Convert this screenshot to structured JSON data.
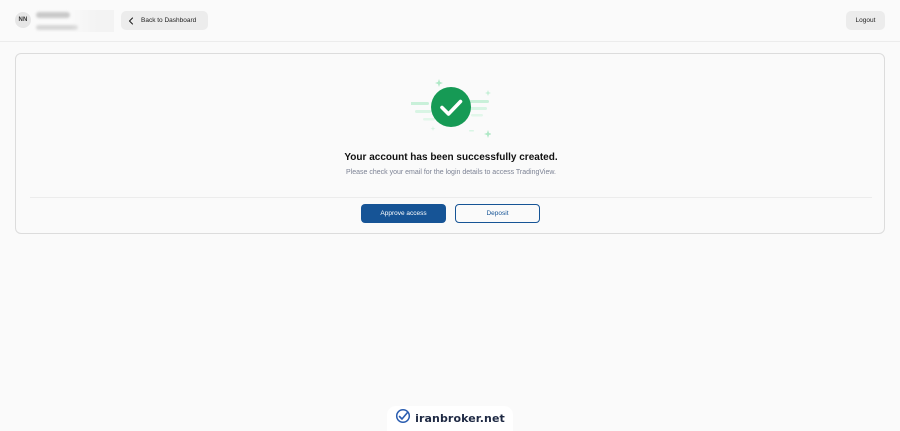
{
  "header": {
    "avatar_initials": "NN",
    "back_label": "Back to Dashboard",
    "logout_label": "Logout"
  },
  "success": {
    "icon": "check-circle-icon",
    "title": "Your account has been successfully created.",
    "message": "Please check your email for the login details to access TradingView."
  },
  "actions": {
    "approve_label": "Approve access",
    "deposit_label": "Deposit"
  },
  "watermark": {
    "text": "iranbroker.net"
  },
  "colors": {
    "primary": "#165496",
    "success": "#169a55",
    "background": "#fafafa"
  }
}
